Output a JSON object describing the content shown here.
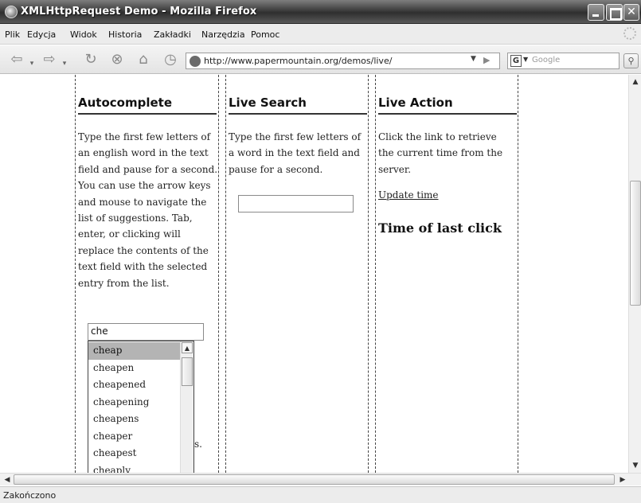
{
  "window": {
    "title": "XMLHttpRequest Demo - Mozilla Firefox"
  },
  "menu": {
    "items": [
      {
        "label": "Plik",
        "icon": ""
      },
      {
        "label": "Edycja",
        "icon": ""
      },
      {
        "label": "Widok",
        "icon": ""
      },
      {
        "label": "Historia",
        "icon": ""
      },
      {
        "label": "Zakładki",
        "icon": ""
      },
      {
        "label": "Narzędzia",
        "icon": ""
      },
      {
        "label": "Pomoc",
        "icon": ""
      }
    ]
  },
  "toolbar": {
    "url": "http://www.papermountain.org/demos/live/",
    "search_placeholder": "Google",
    "search_engine_letter": "G",
    "icons": [
      "back-icon",
      "back-dropdown-icon",
      "forward-icon",
      "forward-dropdown-icon",
      "reload-icon",
      "stop-icon",
      "home-icon",
      "history-icon"
    ]
  },
  "columns": {
    "autocomplete": {
      "heading": "Autocomplete",
      "description": "Type the first few letters of an english word in the text field and pause for a second. You can use the arrow keys and mouse to navigate the list of suggestions. Tab, enter, or clicking will replace the contents of the text field with the selected entry from the list.",
      "input_value": "che",
      "suggestions": [
        "cheap",
        "cheapen",
        "cheapened",
        "cheapening",
        "cheapens",
        "cheaper",
        "cheapest",
        "cheaply"
      ],
      "selected_index": 0,
      "obscured_text": "s."
    },
    "live_search": {
      "heading": "Live Search",
      "description": "Type the first few letters of a word in the text field and pause for a second.",
      "input_value": ""
    },
    "live_action": {
      "heading": "Live Action",
      "description": "Click the link to retrieve the current time from the server.",
      "link_label": "Update time",
      "result_heading": "Time of last click"
    }
  },
  "status": {
    "text": "Zakończono"
  }
}
